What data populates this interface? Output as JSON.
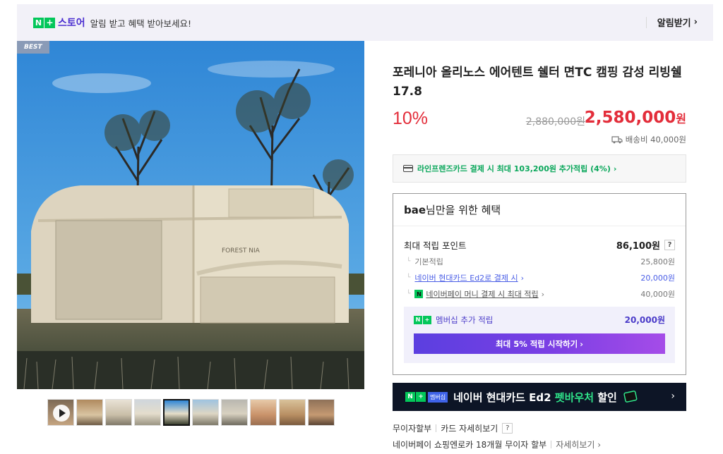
{
  "topbar": {
    "badge_n": "N",
    "badge_plus": "+",
    "store": "스토어",
    "message": "알림 받고 혜택 받아보세요!",
    "subscribe": "알림받기"
  },
  "image": {
    "best_tag": "BEST",
    "tent_logo": "FOREST NIA",
    "thumb_count": 10,
    "active_thumb": 4
  },
  "product": {
    "title": "포레니아 올리노스 에어텐트 쉘터 면TC 캠핑 감성 리빙쉘 17.8",
    "discount": "10%",
    "original_price": "2,880,000원",
    "sale_price": "2,580,000",
    "sale_unit": "원",
    "shipping": "배송비 40,000원"
  },
  "card_promo": "라인프렌즈카드 결제 시 최대 103,200원 추가적립 (4%)",
  "benefit": {
    "user": "bae",
    "head_suffix": "님만을 위한 혜택",
    "max_points_label": "최대 적립 포인트",
    "max_points_value": "86,100원",
    "question": "?",
    "rows": [
      {
        "label": "기본적립",
        "value": "25,800원"
      },
      {
        "label": "네이버 현대카드 Ed2로 결제 시",
        "value": "20,000원"
      },
      {
        "label": "네이버페이 머니 결제 시 최대 적립",
        "value": "40,000원"
      }
    ],
    "npay_mini": "N",
    "member_label": "멤버십 추가 적립",
    "member_value": "20,000원",
    "member_button": "최대 5% 적립 시작하기"
  },
  "banner": {
    "np_n": "N",
    "np_plus": "+",
    "membership": "멤버십",
    "text_a": "네이버 현대카드 Ed2 ",
    "text_b": "펫바우처",
    "text_c": " 할인"
  },
  "installment": {
    "label": "무이자할부",
    "card_detail": "카드 자세히보기",
    "question": "?",
    "npay_label": "네이버페이 쇼핑엔로카 18개월 무이자 할부",
    "detail": "자세히보기"
  },
  "colors": {
    "accent_red": "#e32d3a",
    "naver_green": "#03c75a",
    "purple": "#4b2fd0",
    "banner_bg": "#0d1526"
  }
}
